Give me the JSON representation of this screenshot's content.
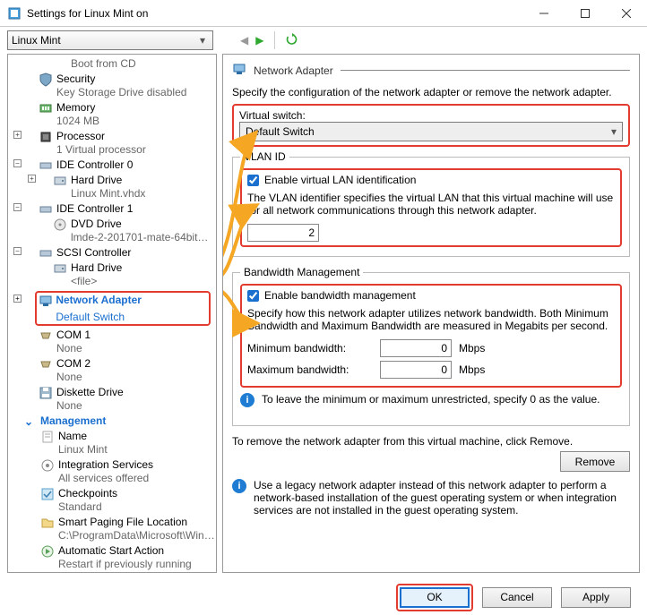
{
  "window": {
    "title": "Settings for Linux Mint on ",
    "vm_name": "Linux Mint"
  },
  "sidebar": {
    "items": [
      {
        "label": "Boot from CD",
        "sub": ""
      },
      {
        "label": "Security",
        "sub": "Key Storage Drive disabled"
      },
      {
        "label": "Memory",
        "sub": "1024 MB"
      },
      {
        "label": "Processor",
        "sub": "1 Virtual processor"
      },
      {
        "label": "IDE Controller 0",
        "sub": ""
      },
      {
        "label": "Hard Drive",
        "sub": "Linux Mint.vhdx"
      },
      {
        "label": "IDE Controller 1",
        "sub": ""
      },
      {
        "label": "DVD Drive",
        "sub": "lmde-2-201701-mate-64bit…"
      },
      {
        "label": "SCSI Controller",
        "sub": ""
      },
      {
        "label": "Hard Drive",
        "sub": "<file>"
      },
      {
        "label": "Network Adapter",
        "sub": "Default Switch"
      },
      {
        "label": "COM 1",
        "sub": "None"
      },
      {
        "label": "COM 2",
        "sub": "None"
      },
      {
        "label": "Diskette Drive",
        "sub": "None"
      }
    ],
    "management_header": "Management",
    "mgmt": [
      {
        "label": "Name",
        "sub": "Linux Mint"
      },
      {
        "label": "Integration Services",
        "sub": "All services offered"
      },
      {
        "label": "Checkpoints",
        "sub": "Standard"
      },
      {
        "label": "Smart Paging File Location",
        "sub": "C:\\ProgramData\\Microsoft\\Win…"
      },
      {
        "label": "Automatic Start Action",
        "sub": "Restart if previously running"
      }
    ]
  },
  "main": {
    "section_title": "Network Adapter",
    "intro": "Specify the configuration of the network adapter or remove the network adapter.",
    "vswitch_label": "Virtual switch:",
    "vswitch_value": "Default Switch",
    "vlan": {
      "legend": "VLAN ID",
      "enable_label": "Enable virtual LAN identification",
      "desc": "The VLAN identifier specifies the virtual LAN that this virtual machine will use for all network communications through this network adapter.",
      "value": "2"
    },
    "bw": {
      "legend": "Bandwidth Management",
      "enable_label": "Enable bandwidth management",
      "desc": "Specify how this network adapter utilizes network bandwidth. Both Minimum Bandwidth and Maximum Bandwidth are measured in Megabits per second.",
      "min_label": "Minimum bandwidth:",
      "max_label": "Maximum bandwidth:",
      "unit": "Mbps",
      "min_value": "0",
      "max_value": "0",
      "info": "To leave the minimum or maximum unrestricted, specify 0 as the value."
    },
    "remove_desc": "To remove the network adapter from this virtual machine, click Remove.",
    "remove_btn": "Remove",
    "legacy_info": "Use a legacy network adapter instead of this network adapter to perform a network-based installation of the guest operating system or when integration services are not installed in the guest operating system."
  },
  "footer": {
    "ok": "OK",
    "cancel": "Cancel",
    "apply": "Apply"
  }
}
